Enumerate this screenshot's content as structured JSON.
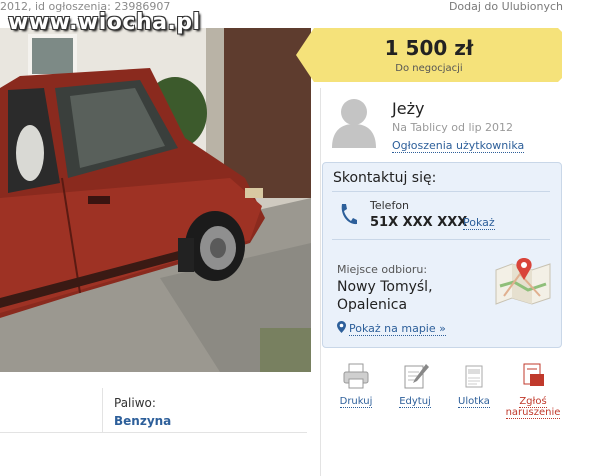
{
  "header": {
    "meta": "2012, id ogłoszenia: 23986907",
    "favorite_link": "Dodaj do Ulubionych",
    "watermark": "www.wiocha.pl"
  },
  "price": {
    "value": "1 500 zł",
    "note": "Do negocjacji",
    "tag_color": "#f5e27a"
  },
  "seller": {
    "name": "Jeży",
    "since": "Na Tablicy od lip 2012",
    "ads_link": "Ogłoszenia użytkownika",
    "avatar_icon": "user-silhouette-icon"
  },
  "contact": {
    "title": "Skontaktuj się:",
    "phone_label": "Telefon",
    "phone_number": "51X XXX XXX",
    "phone_show": "Pokaż",
    "pickup_label": "Miejsce odbioru:",
    "city": "Nowy Tomyśl,",
    "district": "Opalenica",
    "map_link": "Pokaż na mapie »",
    "box_color": "#eaf1fa"
  },
  "tools": [
    {
      "label": "Drukuj",
      "icon": "printer-icon"
    },
    {
      "label": "Edytuj",
      "icon": "edit-icon"
    },
    {
      "label": "Ulotka",
      "icon": "flyer-icon"
    },
    {
      "label": "Zgłoś naruszenie",
      "icon": "report-flag-icon"
    }
  ],
  "params": {
    "fuel_label": "Paliwo:",
    "fuel_value": "Benzyna"
  }
}
